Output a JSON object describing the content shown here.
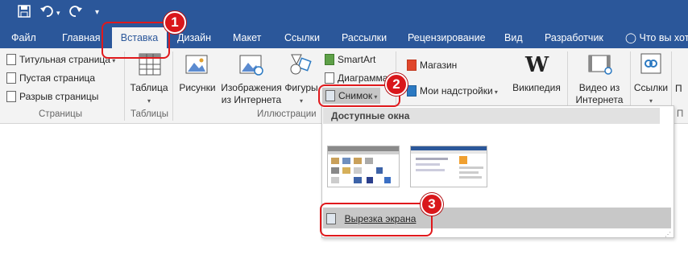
{
  "qat": {
    "save_icon": "save-icon",
    "undo_icon": "undo-icon",
    "redo_icon": "redo-icon",
    "customize_icon": "customize-icon"
  },
  "tabs": [
    "Файл",
    "Главная",
    "Вставка",
    "Дизайн",
    "Макет",
    "Ссылки",
    "Рассылки",
    "Рецензирование",
    "Вид",
    "Разработчик"
  ],
  "tell_me": "Что вы хоти",
  "ribbon": {
    "pages": {
      "cover": "Титульная страница",
      "blank": "Пустая страница",
      "break": "Разрыв страницы",
      "label": "Страницы"
    },
    "tables": {
      "table": "Таблица",
      "label": "Таблицы"
    },
    "illustrations": {
      "pictures": "Рисунки",
      "online_pictures_1": "Изображения",
      "online_pictures_2": "из Интернета",
      "shapes": "Фигуры",
      "smartart": "SmartArt",
      "chart": "Диаграмма",
      "screenshot": "Снимок",
      "label": "Иллюстрации"
    },
    "addins": {
      "store": "Магазин",
      "my_addins": "Мои надстройки",
      "wikipedia": "Википедия"
    },
    "media": {
      "video_1": "Видео из",
      "video_2": "Интернета"
    },
    "links": {
      "links": "Ссылки",
      "label_cut": "П",
      "label_bottom": "П"
    }
  },
  "dropdown": {
    "header": "Доступные окна",
    "screen_clipping": "Вырезка экрана"
  },
  "annotations": [
    "1",
    "2",
    "3"
  ],
  "colors": {
    "title_bar": "#2b579a",
    "annotation": "#e0191c"
  }
}
